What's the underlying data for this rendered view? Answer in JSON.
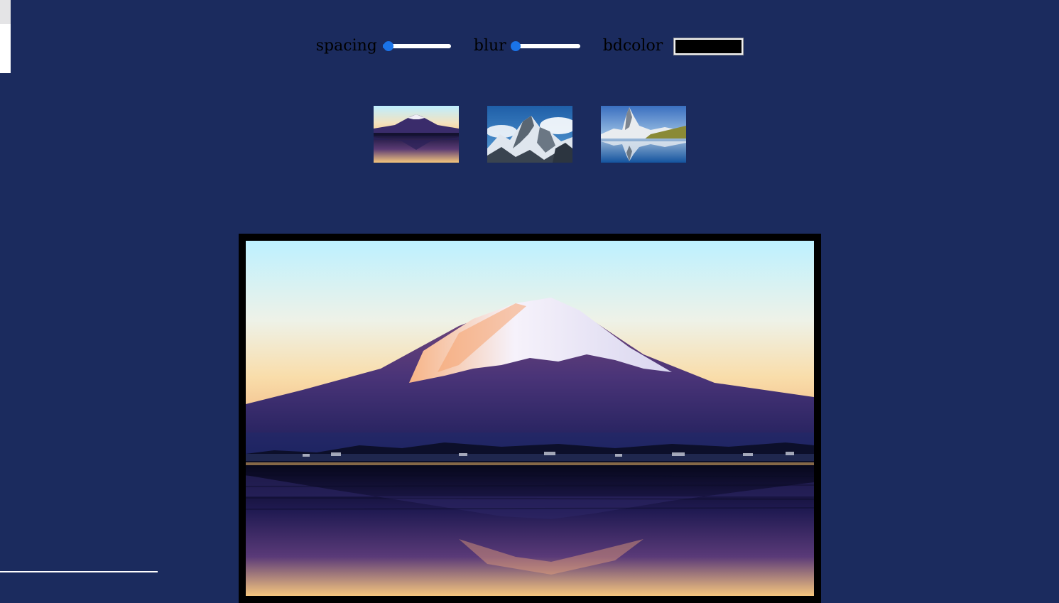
{
  "controls": {
    "spacing": {
      "label": "spacing",
      "value": 0.03
    },
    "blur": {
      "label": "blur",
      "value": 0.0
    },
    "bdcolor": {
      "label": "bdcolor",
      "value": "#000000"
    }
  },
  "colors": {
    "background": "#1b2b5e",
    "accent": "#1a73e8",
    "border": "#000000"
  },
  "thumbnails": [
    {
      "name": "mount-fuji-thumbnail",
      "selected": true
    },
    {
      "name": "everest-thumbnail",
      "selected": false
    },
    {
      "name": "matterhorn-thumbnail",
      "selected": false
    }
  ],
  "main_image": {
    "name": "mount-fuji-reflection"
  }
}
